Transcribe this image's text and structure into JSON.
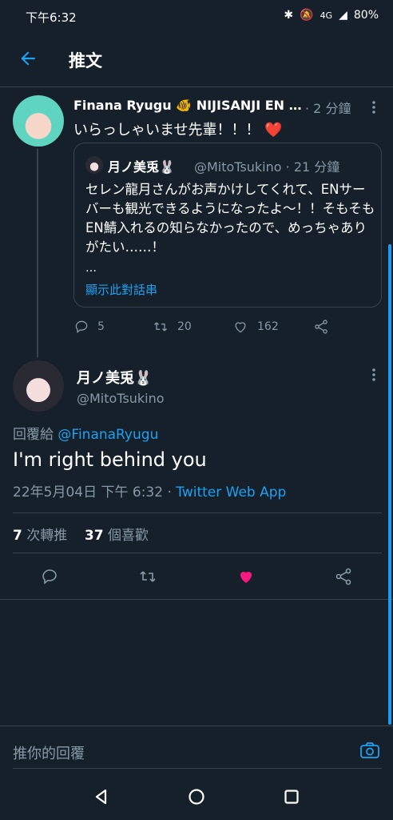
{
  "status_bar": {
    "time": "下午6:32",
    "signal": "4G",
    "battery": "80%"
  },
  "header": {
    "title": "推文"
  },
  "tweet1": {
    "name": "Finana Ryugu 🐠 NIJISANJI EN …",
    "time": "· 2 分鐘",
    "text": "いらっしゃいませ先輩！！！ ❤️",
    "quote": {
      "name": "月ノ美兎🐰",
      "handle": "@MitoTsukino · 21 分鐘",
      "text": "セレン龍月さんがお声かけしてくれて、ENサーバーも観光できるようになったよ〜！！そもそもEN鯖入れるの知らなかったので、めっちゃありがたい……！",
      "ellipsis": "…",
      "link": "顯示此對話串"
    },
    "counts": {
      "replies": "5",
      "retweets": "20",
      "likes": "162"
    }
  },
  "main_tweet": {
    "name": "月ノ美兎🐰",
    "handle": "@MitoTsukino",
    "reply_prefix": "回覆給",
    "reply_to": "@FinanaRyugu",
    "text": "I'm right behind you",
    "datetime": "22年5月04日 下午 6:32 · ",
    "source": "Twitter Web App",
    "retweets_num": "7",
    "retweets_label": "次轉推",
    "likes_num": "37",
    "likes_label": "個喜歡"
  },
  "compose": {
    "placeholder": "推你的回覆"
  },
  "colors": {
    "accent": "#1da1f2",
    "like": "#f91880",
    "bg": "#15202b"
  },
  "icons": [
    "back-arrow-icon",
    "reply-icon",
    "retweet-icon",
    "heart-icon",
    "share-icon",
    "more-icon",
    "camera-icon",
    "nav-back-icon",
    "nav-home-icon",
    "nav-recents-icon"
  ]
}
